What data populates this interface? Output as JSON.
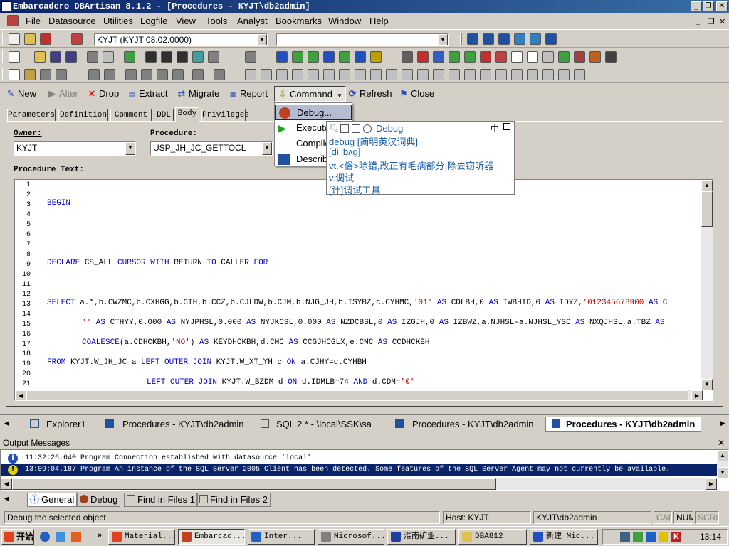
{
  "window": {
    "title": "Embarcadero DBArtisan 8.1.2 - [Procedures - KYJT\\db2admin]",
    "btn_min": "_",
    "btn_restore": "❐",
    "btn_close": "✕"
  },
  "menubar": {
    "items": [
      "File",
      "Datasource",
      "Utilities",
      "Logfile",
      "View",
      "Tools",
      "Analyst",
      "Bookmarks",
      "Window",
      "Help"
    ],
    "mdi_min": "_",
    "mdi_restore": "❐",
    "mdi_close": "✕"
  },
  "toolbar": {
    "datasource_value": "KYJT (KYJT 08.02.0000)",
    "second_combo_value": ""
  },
  "commandbar": {
    "new": "New",
    "alter": "Alter",
    "drop": "Drop",
    "extract": "Extract",
    "migrate": "Migrate",
    "report": "Report",
    "command": "Command",
    "refresh": "Refresh",
    "close": "Close"
  },
  "command_menu": {
    "items": [
      "Debug...",
      "Execute",
      "Compile",
      "Describe"
    ]
  },
  "dict_tooltip": {
    "header": "Debug",
    "ime_label": "中",
    "line1": "debug [简明英汉词典]",
    "line2": "[diː'bʌg]",
    "line3": "vt.<俗>除错,改正有毛病部分,除去窃听器",
    "line4": "v.调试",
    "line5": "[计]调试工具"
  },
  "editor_tabs": [
    "Parameters",
    "Definition",
    "Comment",
    "DDL",
    "Body",
    "Privileges"
  ],
  "form": {
    "owner_label": "Owner:",
    "owner_value": "KYJT",
    "procedure_label": "Procedure:",
    "procedure_value": "USP_JH_JC_GETTOCL",
    "text_label": "Procedure Text:"
  },
  "code": {
    "line_numbers": [
      "1",
      "2",
      "3",
      "4",
      "5",
      "6",
      "7",
      "8",
      "9",
      "10",
      "11",
      "12",
      "13",
      "14",
      "15",
      "16",
      "17",
      "18",
      "19",
      "20",
      "21"
    ],
    "l3": "BEGIN",
    "l9a": "DECLARE",
    "l9b": " CS_ALL ",
    "l9c": "CURSOR WITH",
    "l9d": " RETURN ",
    "l9e": "TO",
    "l9f": " CALLER ",
    "l9g": "FOR",
    "l13a": "SELECT",
    "l13b": " a.*,b.CWZMC,b.CXHGG,b.CTH,b.CCZ,b.CJLDW,b.CJM,b.NJG_JH,b.ISYBZ,c.CYHMC,",
    "l13c": "'01'",
    "l13d": " AS ",
    "l13e": "CDLBH,0 ",
    "l13f": "AS",
    "l13g": " IWBHID,0 ",
    "l13h": "AS",
    "l13i": " IDYZ,",
    "l13j": "'012345678900'",
    "l13k": "AS C",
    "l15a": "''",
    "l15b": " AS ",
    "l15c": "CTHYY,0.000 ",
    "l15d": "AS",
    "l15e": " NYJPHSL,0.000 ",
    "l15f": "AS",
    "l15g": " NYJKCSL,0.000 ",
    "l15h": "AS",
    "l15i": " NZDCBSL,0 ",
    "l15j": "AS",
    "l15k": " IZGJH,0 ",
    "l15l": "AS",
    "l15m": " IZBWZ,a.NJHSL-a.NJHSL_YSC ",
    "l15n": "AS",
    "l15o": " NXQJHSL,a.TBZ ",
    "l15p": "AS",
    "l17a": "COALESCE",
    "l17b": "(a.CDHCKBH,",
    "l17c": "'NO'",
    "l17d": ") ",
    "l17e": "AS",
    "l17f": " KEYDHCKBH,d.CMC ",
    "l17g": "AS",
    "l17h": " CCGJHCGLX,e.CMC ",
    "l17i": "AS",
    "l17j": " CCDHCKBH",
    "l19a": "FROM",
    "l19b": " KYJT.W_JH_JC a ",
    "l19c": "LEFT OUTER JOIN",
    "l19d": " KYJT.W_XT_YH c ",
    "l19e": "ON",
    "l19f": " a.CJHY=c.CYHBH",
    "l21a": "LEFT OUTER JOIN",
    "l21b": " KYJT.W_BZDM d ",
    "l21c": "ON",
    "l21d": " d.IDMLB=74 ",
    "l21e": "AND",
    "l21f": " d.CDM=",
    "l21g": "'0'"
  },
  "doc_tabs": [
    "Explorer1",
    "Procedures - KYJT\\db2admin",
    "SQL 2 * - \\local\\SSK\\sa",
    "Procedures - KYJT\\db2admin",
    "Procedures - KYJT\\db2admin"
  ],
  "output": {
    "title": "Output Messages",
    "rows": [
      "11:32:26.640 Program Connection established with datasource 'local'",
      "13:09:04.187 Program An instance of the SQL Server 2005 Client has been detected. Some features of the SQL Server Agent may not currently be available."
    ],
    "tabs": [
      "General",
      "Debug",
      "Find in Files 1",
      "Find in Files 2"
    ]
  },
  "statusbar": {
    "message": "Debug the selected object",
    "host": "Host: KYJT",
    "user": "KYJT\\db2admin",
    "cap": "CAP",
    "num": "NUM",
    "scrl": "SCRL"
  },
  "taskbar": {
    "start": "开始",
    "buttons": [
      "Material...",
      "Embarcad...",
      "Inter...",
      "Microsof...",
      "淮南矿业...",
      "DBA812",
      "新建 Mic..."
    ],
    "clock": "13:14"
  },
  "colors": {
    "title_start": "#0a246a",
    "title_end": "#3a6ea5",
    "keyword": "#0000c0",
    "string": "#c00000",
    "tooltip_text": "#1a5fa8"
  }
}
